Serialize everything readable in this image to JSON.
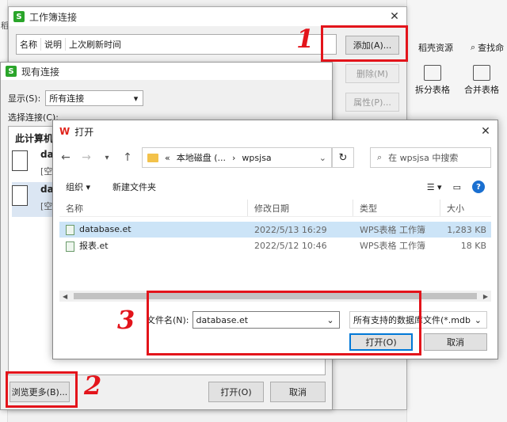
{
  "background_app": {
    "left_strip_text": "稻",
    "tab_daoke": "稻壳资源",
    "tab_search": "查找命",
    "tool_split": "拆分表格",
    "tool_merge": "合并表格"
  },
  "workbook_window": {
    "title": "工作簿连接",
    "columns": [
      "名称",
      "说明",
      "上次刷新时间"
    ],
    "buttons": {
      "add": "添加(A)...",
      "delete": "删除(M)",
      "properties": "属性(P)..."
    }
  },
  "existing_window": {
    "title": "现有连接",
    "show_label": "显示(S):",
    "show_value": "所有连接",
    "select_label": "选择连接(C):",
    "section": "此计算机",
    "items": [
      {
        "name": "dat",
        "sub": "[空"
      },
      {
        "name": "dat",
        "sub": "[空"
      }
    ],
    "buttons": {
      "browse": "浏览更多(B)...",
      "open": "打开(O)",
      "cancel": "取消"
    }
  },
  "open_dialog": {
    "logo": "W",
    "title": "打开",
    "path": [
      "«",
      "本地磁盘 (...",
      "›",
      "wpsjsa"
    ],
    "search_placeholder": "在 wpsjsa 中搜索",
    "toolbar": {
      "organize": "组织",
      "new_folder": "新建文件夹"
    },
    "columns": [
      "名称",
      "修改日期",
      "类型",
      "大小"
    ],
    "files": [
      {
        "name": "database.et",
        "date": "2022/5/13 16:29",
        "type": "WPS表格 工作簿",
        "size": "1,283 KB",
        "selected": true
      },
      {
        "name": "报表.et",
        "date": "2022/5/12 10:46",
        "type": "WPS表格 工作簿",
        "size": "18 KB",
        "selected": false
      }
    ],
    "filename_label": "文件名(N):",
    "filename_value": "database.et",
    "filetype_value": "所有支持的数据库文件(*.mdb",
    "buttons": {
      "open": "打开(O)",
      "cancel": "取消"
    }
  },
  "annotations": {
    "step1": "1",
    "step2": "2",
    "step3": "3"
  },
  "colors": {
    "annotation_red": "#e3141b",
    "selection_blue": "#cce4f7",
    "wps_red": "#e0241b"
  }
}
